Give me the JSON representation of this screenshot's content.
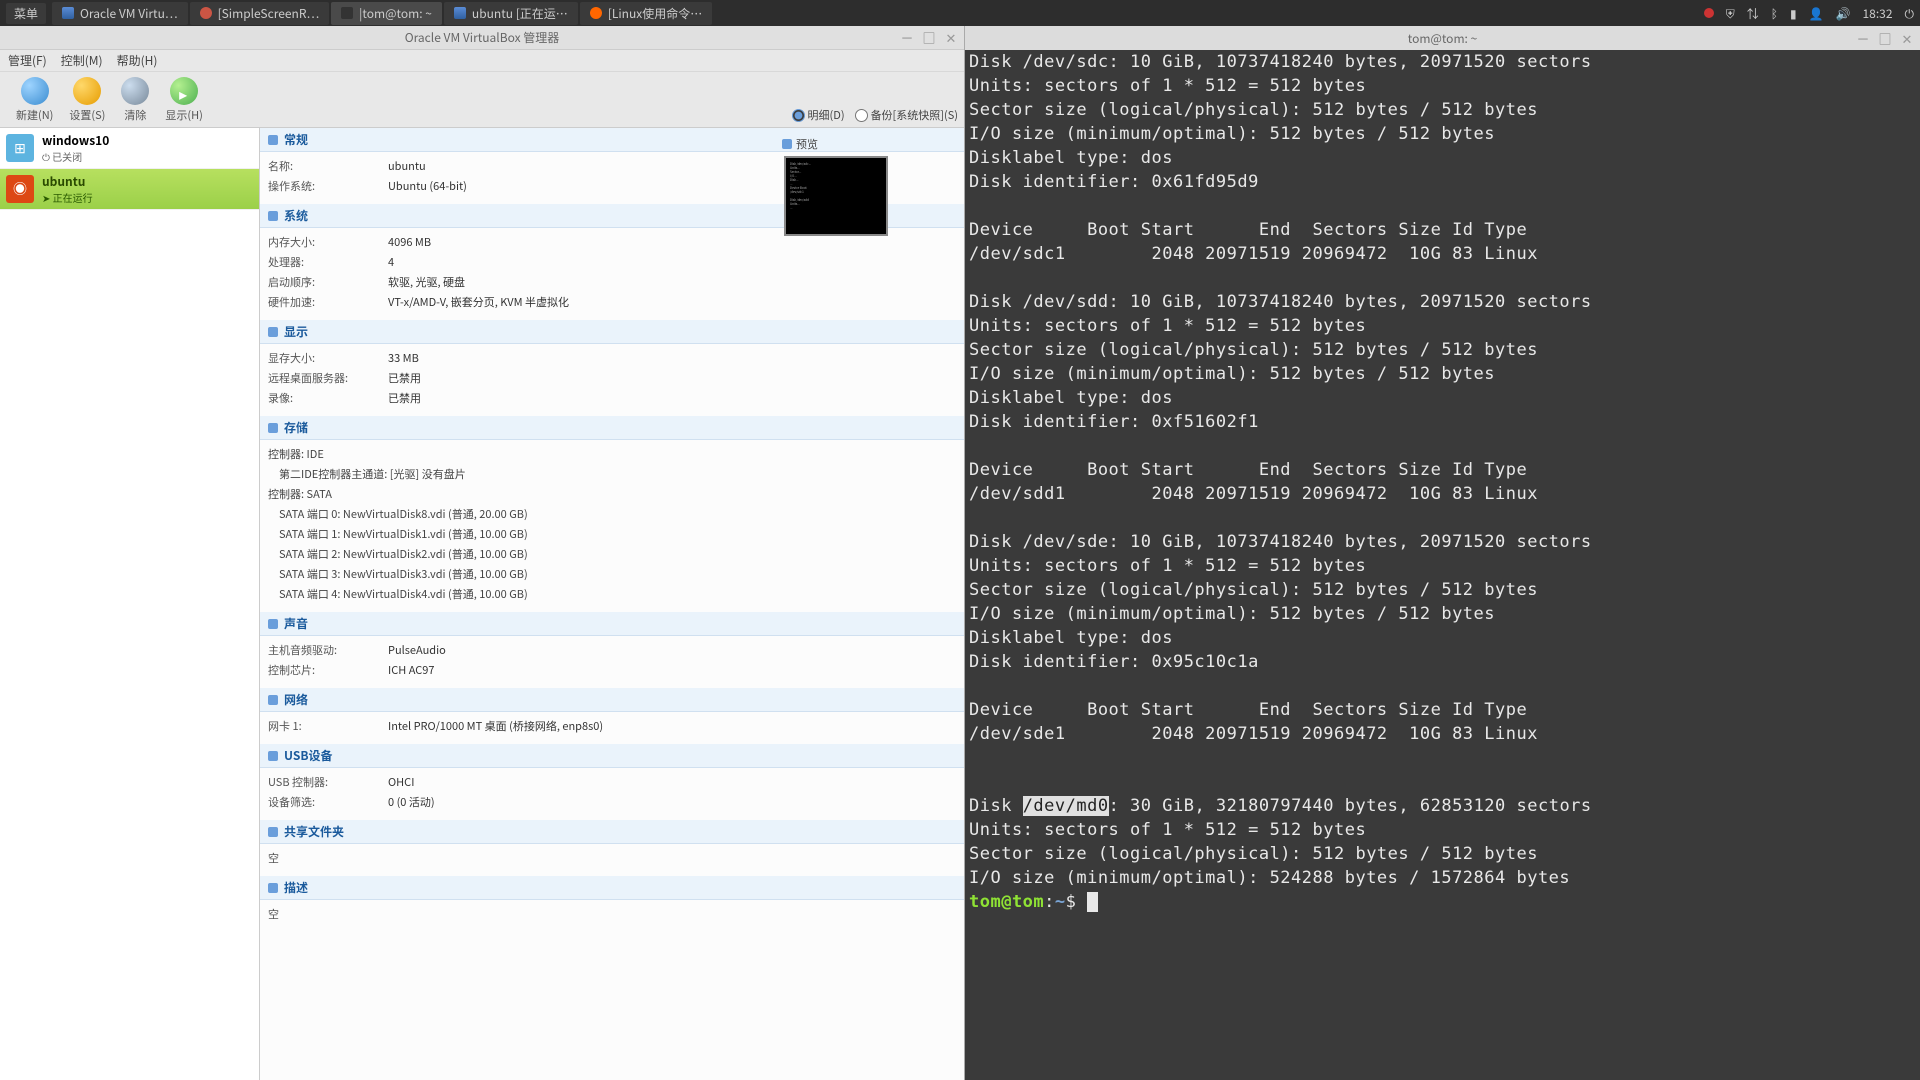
{
  "panel": {
    "menu": "菜单",
    "tasks": [
      {
        "icon": "vbox",
        "label": "Oracle VM Virtu…"
      },
      {
        "icon": "rec",
        "label": "[SimpleScreenR…"
      },
      {
        "icon": "term",
        "label": "|tom@tom: ~",
        "active": true
      },
      {
        "icon": "vbox",
        "label": "ubuntu [正在运…"
      },
      {
        "icon": "ff",
        "label": "[Linux使用命令…"
      }
    ],
    "time": "18:32"
  },
  "vbox": {
    "title": "Oracle VM VirtualBox 管理器",
    "menus": [
      "管理(F)",
      "控制(M)",
      "帮助(H)"
    ],
    "toolbar": {
      "new": "新建(N)",
      "settings": "设置(S)",
      "discard": "清除",
      "show": "显示(H)",
      "detail": "明细(D)",
      "backup": "备份[系统快照](S)"
    },
    "vms": [
      {
        "name": "windows10",
        "state": "⏻ 已关闭",
        "os": "win"
      },
      {
        "name": "ubuntu",
        "state": "➤ 正在运行",
        "os": "ub",
        "selected": true
      }
    ],
    "preview_hdr": "预览",
    "sections": {
      "general": {
        "title": "常规",
        "props": [
          [
            "名称:",
            "ubuntu"
          ],
          [
            "操作系统:",
            "Ubuntu (64-bit)"
          ]
        ]
      },
      "system": {
        "title": "系统",
        "props": [
          [
            "内存大小:",
            "4096 MB"
          ],
          [
            "处理器:",
            "4"
          ],
          [
            "启动顺序:",
            "软驱, 光驱, 硬盘"
          ],
          [
            "硬件加速:",
            "VT-x/AMD-V, 嵌套分页, KVM 半虚拟化"
          ]
        ]
      },
      "display": {
        "title": "显示",
        "props": [
          [
            "显存大小:",
            "33 MB"
          ],
          [
            "远程桌面服务器:",
            "已禁用"
          ],
          [
            "录像:",
            "已禁用"
          ]
        ]
      },
      "storage": {
        "title": "存储",
        "rows": [
          "控制器: IDE",
          "　第二IDE控制器主通道:  [光驱] 没有盘片",
          "控制器: SATA",
          "　SATA 端口 0:                        NewVirtualDisk8.vdi (普通, 20.00 GB)",
          "　SATA 端口 1:                        NewVirtualDisk1.vdi (普通, 10.00 GB)",
          "　SATA 端口 2:                        NewVirtualDisk2.vdi (普通, 10.00 GB)",
          "　SATA 端口 3:                        NewVirtualDisk3.vdi (普通, 10.00 GB)",
          "　SATA 端口 4:                        NewVirtualDisk4.vdi (普通, 10.00 GB)"
        ]
      },
      "audio": {
        "title": "声音",
        "props": [
          [
            "主机音频驱动:",
            "PulseAudio"
          ],
          [
            "控制芯片:",
            "ICH AC97"
          ]
        ]
      },
      "network": {
        "title": "网络",
        "props": [
          [
            "网卡 1:",
            "Intel PRO/1000 MT 桌面 (桥接网络, enp8s0)"
          ]
        ]
      },
      "usb": {
        "title": "USB设备",
        "props": [
          [
            "USB 控制器:",
            "OHCI"
          ],
          [
            "设备筛选:",
            "0 (0 活动)"
          ]
        ]
      },
      "shared": {
        "title": "共享文件夹",
        "props": [
          [
            "空",
            ""
          ]
        ]
      },
      "desc": {
        "title": "描述",
        "props": [
          [
            "空",
            ""
          ]
        ]
      }
    }
  },
  "terminal": {
    "title": "tom@tom: ~",
    "blocks": [
      {
        "header": [
          "Disk /dev/sdc: 10 GiB, 10737418240 bytes, 20971520 sectors",
          "Units: sectors of 1 * 512 = 512 bytes",
          "Sector size (logical/physical): 512 bytes / 512 bytes",
          "I/O size (minimum/optimal): 512 bytes / 512 bytes",
          "Disklabel type: dos",
          "Disk identifier: 0x61fd95d9"
        ],
        "cols": "Device     Boot Start      End  Sectors Size Id Type",
        "row": "/dev/sdc1        2048 20971519 20969472  10G 83 Linux"
      },
      {
        "header": [
          "Disk /dev/sdd: 10 GiB, 10737418240 bytes, 20971520 sectors",
          "Units: sectors of 1 * 512 = 512 bytes",
          "Sector size (logical/physical): 512 bytes / 512 bytes",
          "I/O size (minimum/optimal): 512 bytes / 512 bytes",
          "Disklabel type: dos",
          "Disk identifier: 0xf51602f1"
        ],
        "cols": "Device     Boot Start      End  Sectors Size Id Type",
        "row": "/dev/sdd1        2048 20971519 20969472  10G 83 Linux"
      },
      {
        "header": [
          "Disk /dev/sde: 10 GiB, 10737418240 bytes, 20971520 sectors",
          "Units: sectors of 1 * 512 = 512 bytes",
          "Sector size (logical/physical): 512 bytes / 512 bytes",
          "I/O size (minimum/optimal): 512 bytes / 512 bytes",
          "Disklabel type: dos",
          "Disk identifier: 0x95c10c1a"
        ],
        "cols": "Device     Boot Start      End  Sectors Size Id Type",
        "row": "/dev/sde1        2048 20971519 20969472  10G 83 Linux"
      },
      {
        "md": {
          "pre": "Disk ",
          "hl": "/dev/md0",
          "post": ": 30 GiB, 32180797440 bytes, 62853120 sectors",
          "lines": [
            "Units: sectors of 1 * 512 = 512 bytes",
            "Sector size (logical/physical): 512 bytes / 512 bytes",
            "I/O size (minimum/optimal): 524288 bytes / 1572864 bytes"
          ]
        }
      }
    ],
    "prompt": {
      "user": "tom@tom",
      "path": "~",
      "sym": "$"
    }
  }
}
